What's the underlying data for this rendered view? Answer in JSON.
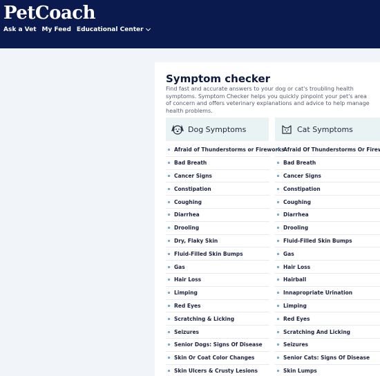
{
  "header": {
    "logo": "PetCoach",
    "nav": [
      {
        "label": "Ask a Vet"
      },
      {
        "label": "My Feed"
      },
      {
        "label": "Educational Center"
      }
    ]
  },
  "main": {
    "title": "Symptom checker",
    "description": "Find fast and accurate answers to your dog or cat's troubling health symptoms. Symptom Checker helps you quickly pinpoint your pet's area of concern and offers veterinary explanations and advice to help manage health problems.",
    "dog": {
      "heading": "Dog Symptoms",
      "icon": "dog-face-icon",
      "items": [
        "Afraid of Thunderstorms or Fireworks",
        "Bad Breath",
        "Cancer Signs",
        "Constipation",
        "Coughing",
        "Diarrhea",
        "Drooling",
        "Dry, Flaky Skin",
        "Fluid-Filled Skin Bumps",
        "Gas",
        "Hair Loss",
        "Limping",
        "Red Eyes",
        "Scratching & Licking",
        "Seizures",
        "Senior Dogs: Signs Of Disease",
        "Skin Or Coat Color Changes",
        "Skin Ulcers & Crusty Lesions"
      ]
    },
    "cat": {
      "heading": "Cat Symptoms",
      "icon": "cat-face-icon",
      "items": [
        "Afraid Of Thunderstorms Or Fireworks",
        "Bad Breath",
        "Cancer Signs",
        "Constipation",
        "Coughing",
        "Diarrhea",
        "Drooling",
        "Fluid-Filled Skin Bumps",
        "Gas",
        "Hair Loss",
        "Hairball",
        "Innapropriate Urination",
        "Limping",
        "Red Eyes",
        "Scratching And Licking",
        "Seizures",
        "Senior Cats: Signs Of Disease",
        "Skin Lumps"
      ]
    }
  },
  "colors": {
    "header_bg": "#0a1a4f",
    "bullet": "#4a8fb5",
    "column_header_bg": "#e9f3f4"
  }
}
